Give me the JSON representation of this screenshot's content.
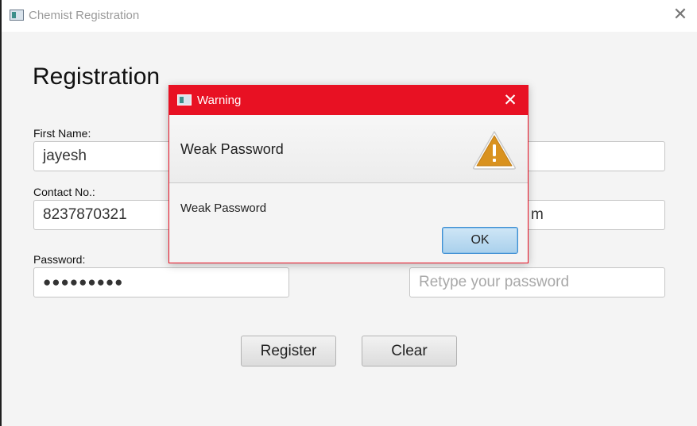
{
  "window": {
    "title": "Chemist Registration",
    "close_glyph": "✕"
  },
  "form": {
    "title": "Registration",
    "first_name": {
      "label": "First Name:",
      "value": "jayesh"
    },
    "contact": {
      "label": "Contact No.:",
      "value": "8237870321"
    },
    "email": {
      "value_visible": "m"
    },
    "password": {
      "label": "Password:",
      "value": "●●●●●●●●●"
    },
    "retype_password": {
      "placeholder": "Retype your password"
    },
    "register_label": "Register",
    "clear_label": "Clear"
  },
  "dialog": {
    "title": "Warning",
    "close_glyph": "✕",
    "header_text": "Weak Password",
    "content_text": "Weak Password",
    "ok_label": "OK",
    "icon": "warning-triangle-icon"
  },
  "colors": {
    "dialog_titlebar": "#e81123",
    "ok_button": "#a9d0ec",
    "warning_icon": "#d9921f"
  }
}
